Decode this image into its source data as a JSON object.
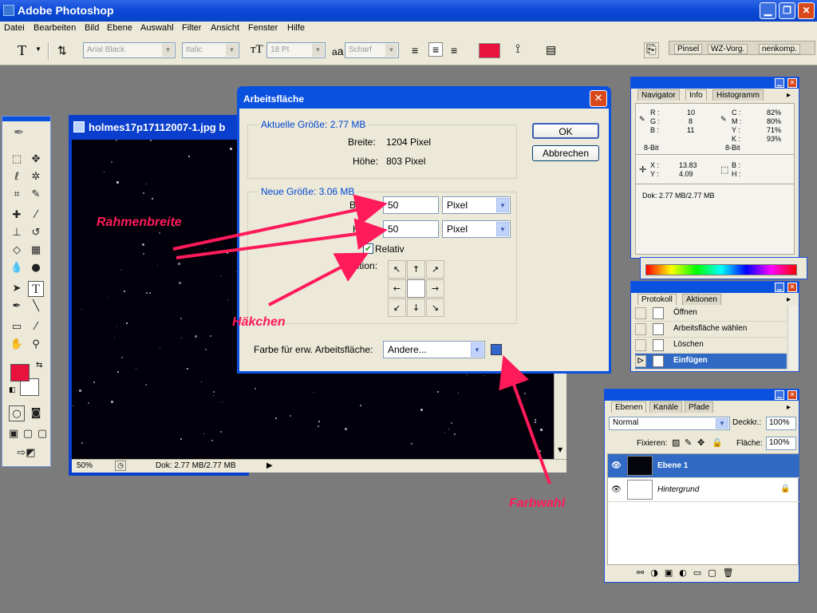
{
  "app": {
    "title": "Adobe Photoshop"
  },
  "menu": [
    "Datei",
    "Bearbeiten",
    "Bild",
    "Ebene",
    "Auswahl",
    "Filter",
    "Ansicht",
    "Fenster",
    "Hilfe"
  ],
  "options": {
    "tool_glyph": "T",
    "font_family": "Arial Black",
    "font_style": "Italic",
    "font_size": "18 Pt",
    "aa_label": "a",
    "antialias": "Scharf",
    "text_color": "#e8123c",
    "palette_tabs": [
      "Pinsel",
      "WZ-Vorg.",
      "nenkomp."
    ]
  },
  "document": {
    "title": "holmes17p17112007-1.jpg b",
    "zoom": "50%",
    "doc_info": "Dok: 2.77 MB/2.77 MB"
  },
  "dialog": {
    "title": "Arbeitsfläche",
    "current_legend": "Aktuelle Größe: 2.77 MB",
    "width_label": "Breite:",
    "width_value": "1204 Pixel",
    "height_label": "Höhe:",
    "height_value": "803 Pixel",
    "new_legend": "Neue Größe: 3.06 MB",
    "new_width_label": "Breite:",
    "new_width_value": "50",
    "new_width_unit": "Pixel",
    "new_height_label": "Höhe:",
    "new_height_value": "50",
    "new_height_unit": "Pixel",
    "relative_label": "Relativ",
    "relative_checked": true,
    "position_label": "Position:",
    "ext_color_label": "Farbe für erw. Arbeitsfläche:",
    "ext_color_value": "Andere...",
    "ext_color_swatch": "#3366cc",
    "ok": "OK",
    "cancel": "Abbrechen"
  },
  "info_panel": {
    "tabs": [
      "Navigator",
      "Info",
      "Histogramm"
    ],
    "r_label": "R :",
    "r": "10",
    "g_label": "G :",
    "g": "8",
    "b_label": "B :",
    "b": "11",
    "c_label": "C :",
    "c": "82%",
    "m_label": "M :",
    "m": "80%",
    "y_label": "Y :",
    "y": "71%",
    "k_label": "K :",
    "k": "93%",
    "bit_left": "8-Bit",
    "bit_right": "8-Bit",
    "x_label": "X :",
    "x": "13.83",
    "yy_label": "Y :",
    "yy": "4.09",
    "bw_label": "B :",
    "h_label": "H :",
    "doc": "Dok: 2.77 MB/2.77 MB"
  },
  "history_panel": {
    "tabs": [
      "Protokoll",
      "Aktionen"
    ],
    "items": [
      "Öffnen",
      "Arbeitsfläche wählen",
      "Löschen",
      "Einfügen"
    ]
  },
  "layers_panel": {
    "tabs": [
      "Ebenen",
      "Kanäle",
      "Pfade"
    ],
    "blend_mode": "Normal",
    "opacity_label": "Deckkr.:",
    "opacity": "100%",
    "lock_label": "Fixieren:",
    "fill_label": "Fläche:",
    "fill": "100%",
    "layers": [
      "Ebene 1",
      "Hintergrund"
    ]
  },
  "annotations": {
    "border_width": "Rahmenbreite",
    "checkmark": "Häkchen",
    "color_choice": "Farbwahl",
    "color": "#ff1a5a"
  }
}
